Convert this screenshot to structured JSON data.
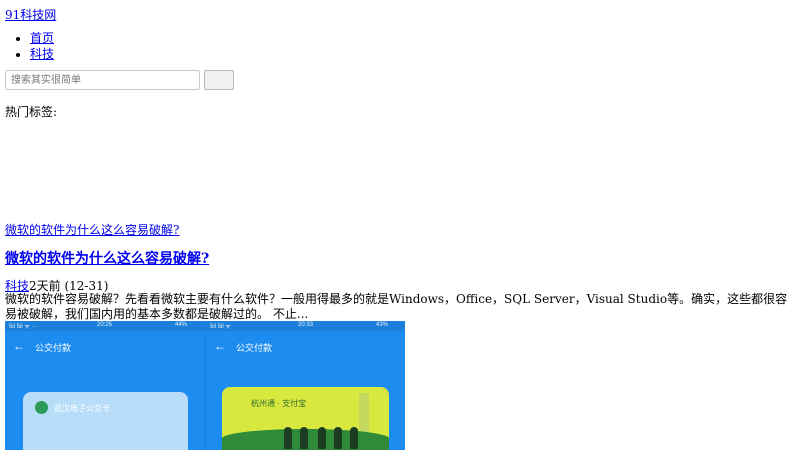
{
  "site": {
    "name": "91科技网"
  },
  "nav": {
    "items": [
      {
        "label": "首页"
      },
      {
        "label": "科技"
      }
    ]
  },
  "search": {
    "placeholder": "搜索其实很简单",
    "button_label": ""
  },
  "tags": {
    "label": "热门标签:"
  },
  "article": {
    "thumb_link": "微软的软件为什么这么容易破解? ",
    "title": "微软的软件为什么这么容易破解? ",
    "category": "科技",
    "date": "2天前 (12-31)",
    "excerpt": "微软的软件容易破解？先看看微软主要有什么软件？一般用得最多的就是Windows，Office，SQL Server，Visual Studio等。确实，这些都很容易被破解，我们国内用的基本多数都是破解过的。 不止..."
  },
  "screenshot": {
    "left": {
      "status_left": "5il 5il ᯤ ···",
      "time": "20:25",
      "battery": "44%",
      "back": "←",
      "title": "公交付款",
      "card_text": "武汉电子公交卡"
    },
    "right": {
      "status_left": "5il 5il ᯤ",
      "time": "20:33",
      "battery": "43%",
      "back": "←",
      "title": "公交付款",
      "card_text": "杭州通 · 支付宝"
    }
  }
}
